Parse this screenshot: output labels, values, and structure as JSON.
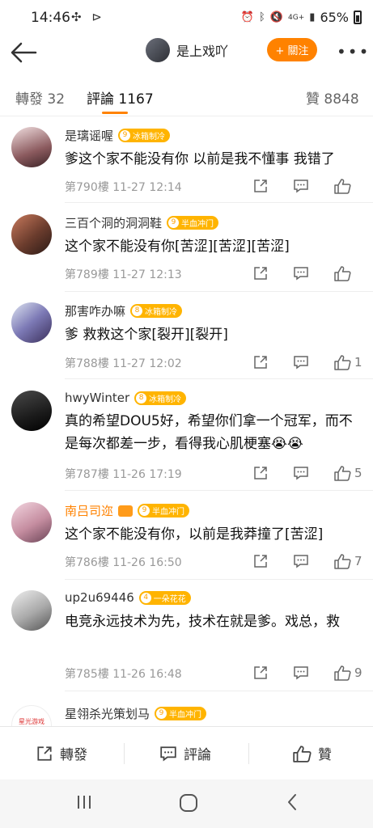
{
  "status_bar": {
    "time": "14:46",
    "battery": "65%",
    "network": "4G+"
  },
  "header": {
    "user_name": "是上戏吖",
    "follow_label": "+ 關注"
  },
  "tabs": {
    "repost": "轉發 32",
    "comments": "評論 1167",
    "likes": "贊 8848"
  },
  "comments": [
    {
      "name": "是璃谣喔",
      "badge_level": "9",
      "badge": "冰箱制冷",
      "text": "爹这个家不能没有你 以前是我不懂事 我错了",
      "floor": "第790樓",
      "time": "11-27 12:14",
      "likes": ""
    },
    {
      "name": "三百个洞的洞洞鞋",
      "badge_level": "9",
      "badge": "半血冲门",
      "text": "这个家不能没有你[苦涩][苦涩][苦涩]",
      "floor": "第789樓",
      "time": "11-27 12:13",
      "likes": ""
    },
    {
      "name": "那害咋办嘛",
      "badge_level": "8",
      "badge": "冰箱制冷",
      "text": "爹 救救这个家[裂开][裂开]",
      "floor": "第788樓",
      "time": "11-27 12:02",
      "likes": "1"
    },
    {
      "name": "hwyWinter",
      "badge_level": "8",
      "badge": "冰箱制冷",
      "text": "真的希望DOU5好，希望你们拿一个冠军，而不是每次都差一步，看得我心肌梗塞😭😭",
      "floor": "第787樓",
      "time": "11-26 17:19",
      "likes": "5"
    },
    {
      "name": "南吕司迩",
      "badge_level": "9",
      "badge": "半血冲门",
      "text": "这个家不能没有你，以前是我莽撞了[苦涩]",
      "floor": "第786樓",
      "time": "11-26 16:50",
      "likes": "7"
    },
    {
      "name": "up2u69446",
      "badge_level": "4",
      "badge": "一朵花花",
      "text": "电竞永远技术为先，技术在就是爹。戏总，救",
      "floor": "第785樓",
      "time": "11-26 16:48",
      "likes": "9"
    },
    {
      "name": "星翎杀光策划马",
      "badge_level": "9",
      "badge": "半血冲门",
      "avatar_text": "星光游戏",
      "text": "",
      "floor": "",
      "time": "",
      "likes": ""
    }
  ],
  "bottom_bar": {
    "repost": "轉發",
    "comment": "評論",
    "like": "贊"
  },
  "colors": {
    "accent": "#ff8200",
    "badge": "#ffb400",
    "meta": "#999999"
  },
  "icons": [
    "back-arrow-icon",
    "more-icon",
    "repost-icon",
    "comment-icon",
    "like-icon",
    "recents-icon",
    "home-icon",
    "back-icon"
  ]
}
